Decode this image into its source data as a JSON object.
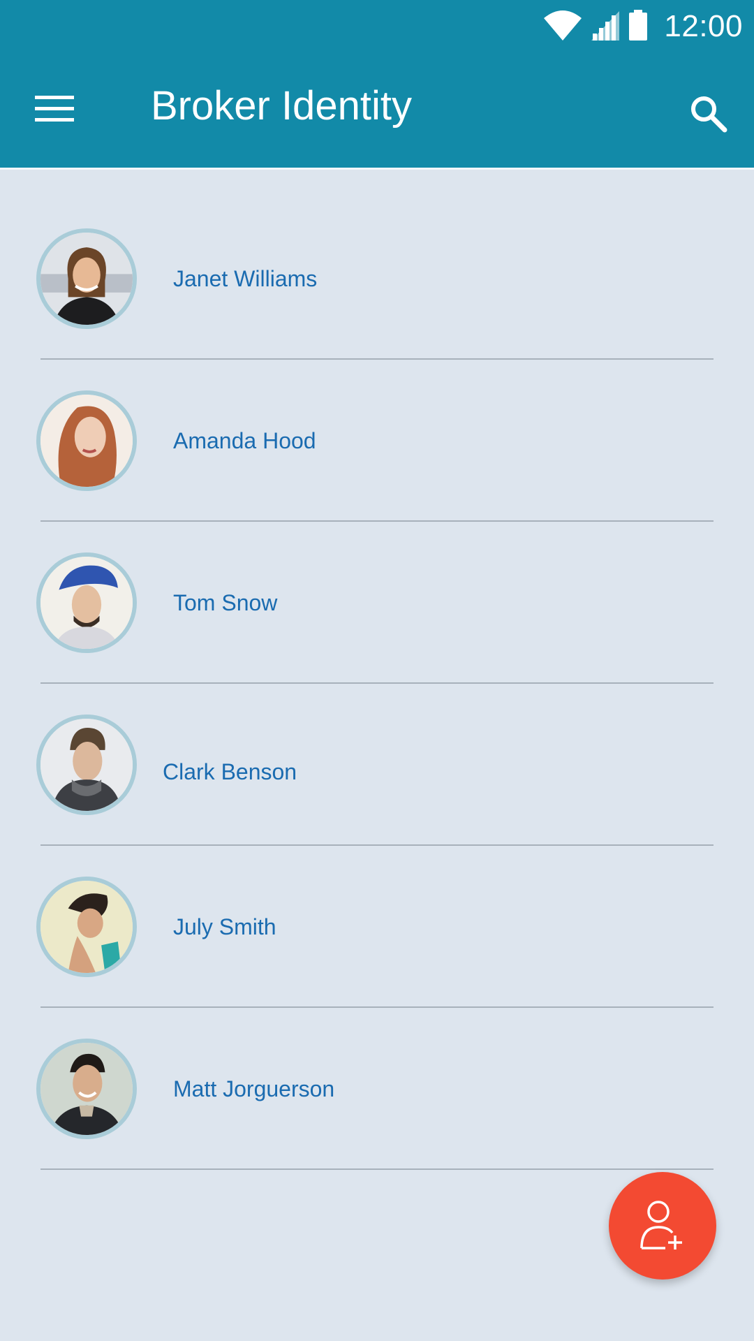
{
  "status_bar": {
    "time": "12:00",
    "icons": [
      "wifi-icon",
      "cellular-signal-icon",
      "battery-icon"
    ]
  },
  "app_bar": {
    "title": "Broker Identity",
    "menu_icon": "hamburger-menu-icon",
    "search_icon": "search-icon",
    "background_color": "#128aa8"
  },
  "contacts": [
    {
      "name": "Janet Williams"
    },
    {
      "name": "Amanda Hood"
    },
    {
      "name": "Tom Snow"
    },
    {
      "name": "Clark Benson"
    },
    {
      "name": "July Smith"
    },
    {
      "name": "Matt Jorguerson"
    }
  ],
  "fab": {
    "icon": "add-person-icon",
    "color": "#f34a32"
  },
  "colors": {
    "page_background": "#dde5ee",
    "name_text": "#1a6bb0",
    "avatar_ring": "#a9ccd8"
  }
}
